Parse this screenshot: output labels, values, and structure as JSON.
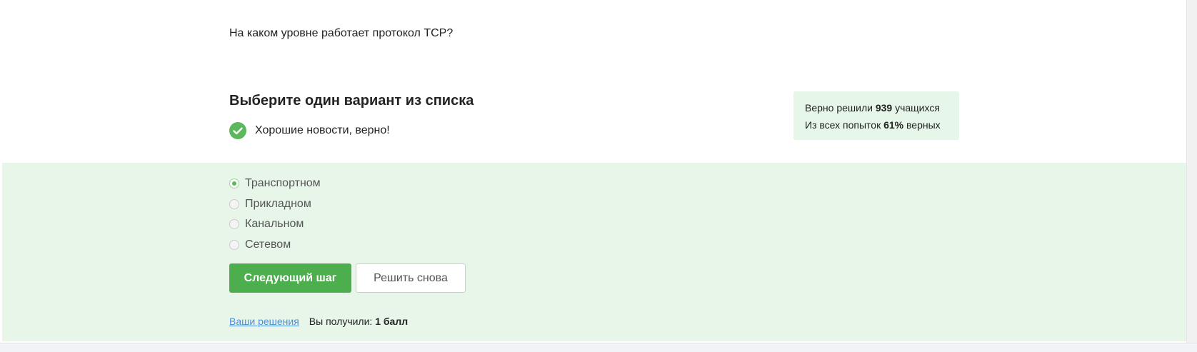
{
  "question": {
    "text": "На каком уровне работает протокол TCP?"
  },
  "task": {
    "title": "Выберите один вариант из списка",
    "feedback": "Хорошие новости, верно!"
  },
  "stats": {
    "solved_prefix": "Верно решили ",
    "solved_count": "939",
    "solved_suffix": " учащихся",
    "attempts_prefix": "Из всех попыток ",
    "attempts_percent": "61%",
    "attempts_suffix": " верных",
    "background_color": "#e6f6e8"
  },
  "options": [
    {
      "label": "Транспортном",
      "selected": true
    },
    {
      "label": "Прикладном",
      "selected": false
    },
    {
      "label": "Канальном",
      "selected": false
    },
    {
      "label": "Сетевом",
      "selected": false
    }
  ],
  "buttons": {
    "next_label": "Следующий шаг",
    "retry_label": "Решить снова",
    "accent_color": "#4cae4c"
  },
  "footer": {
    "solutions_link": "Ваши решения",
    "score_prefix": "Вы получили: ",
    "score_value": "1 балл"
  },
  "icons": {
    "feedback_icon": "check-circle-icon"
  }
}
